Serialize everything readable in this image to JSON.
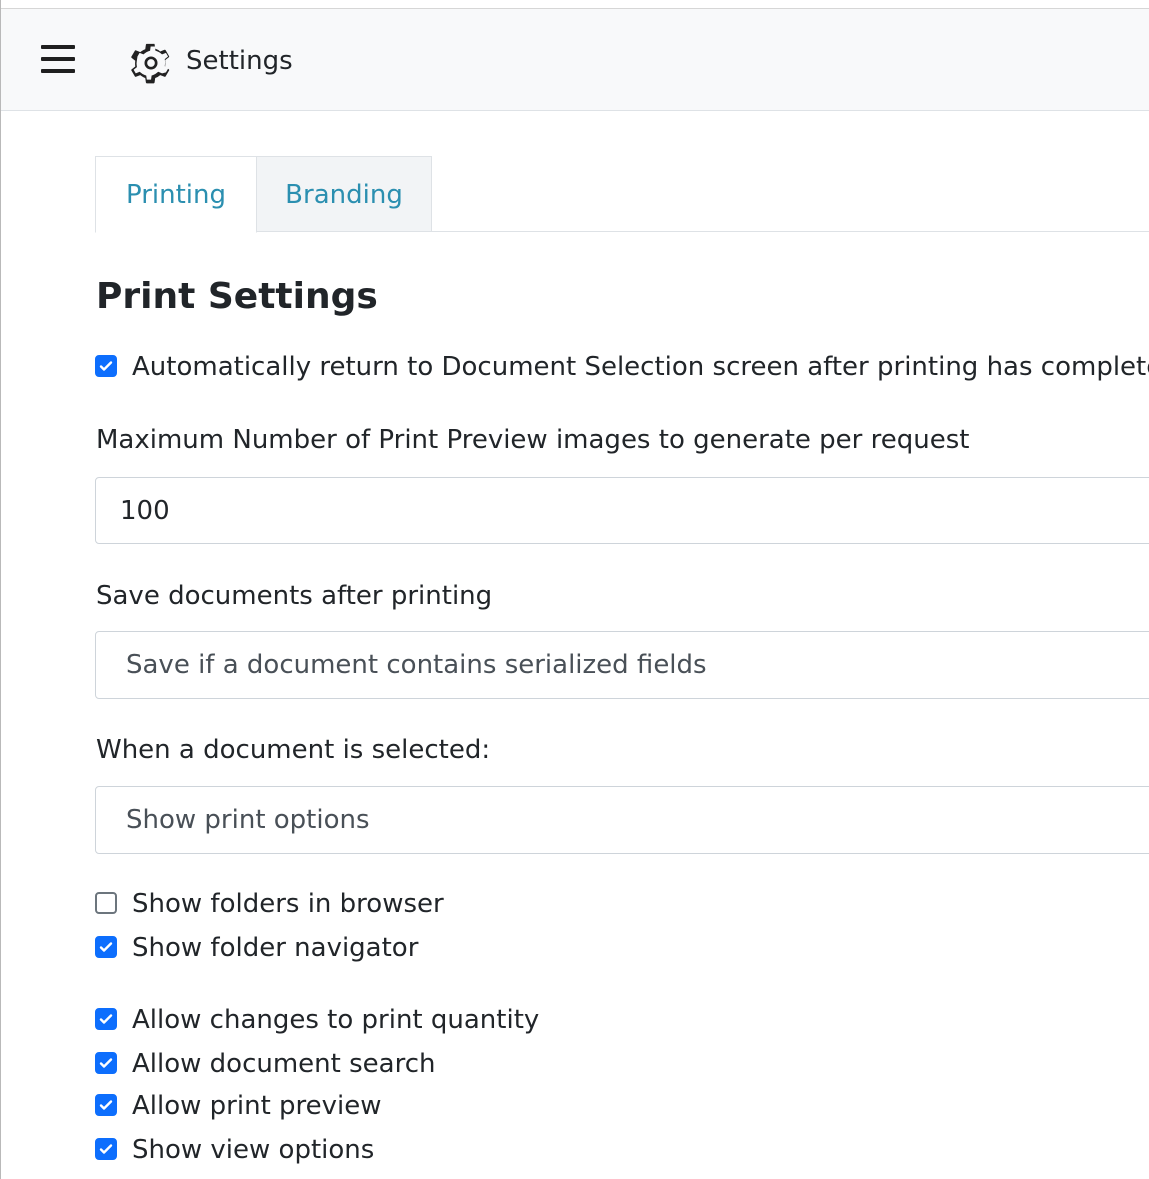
{
  "header": {
    "title": "Settings",
    "menu_icon": "hamburger-menu-icon",
    "settings_icon": "gear-icon"
  },
  "tabs": [
    {
      "label": "Printing",
      "active": true
    },
    {
      "label": "Branding",
      "active": false
    }
  ],
  "section": {
    "title": "Print Settings"
  },
  "options": {
    "auto_return": {
      "label": "Automatically return to Document Selection screen after printing has completed.",
      "checked": true
    },
    "max_preview_label": "Maximum Number of Print Preview images to generate per request",
    "max_preview_value": "100",
    "save_docs_label": "Save documents after printing",
    "save_docs_value": "Save if a document contains serialized fields",
    "on_select_label": "When a document is selected:",
    "on_select_value": "Show print options",
    "show_folders": {
      "label": "Show folders in browser",
      "checked": false
    },
    "show_folder_navigator": {
      "label": "Show folder navigator",
      "checked": true
    },
    "allow_qty": {
      "label": "Allow changes to print quantity",
      "checked": true
    },
    "allow_search": {
      "label": "Allow document search",
      "checked": true
    },
    "allow_preview": {
      "label": "Allow print preview",
      "checked": true
    },
    "show_view_options": {
      "label": "Show view options",
      "checked": true
    }
  },
  "colors": {
    "accent": "#0d6efd",
    "tab_text": "#2b8fb0",
    "header_bg": "#f8f9fa"
  }
}
